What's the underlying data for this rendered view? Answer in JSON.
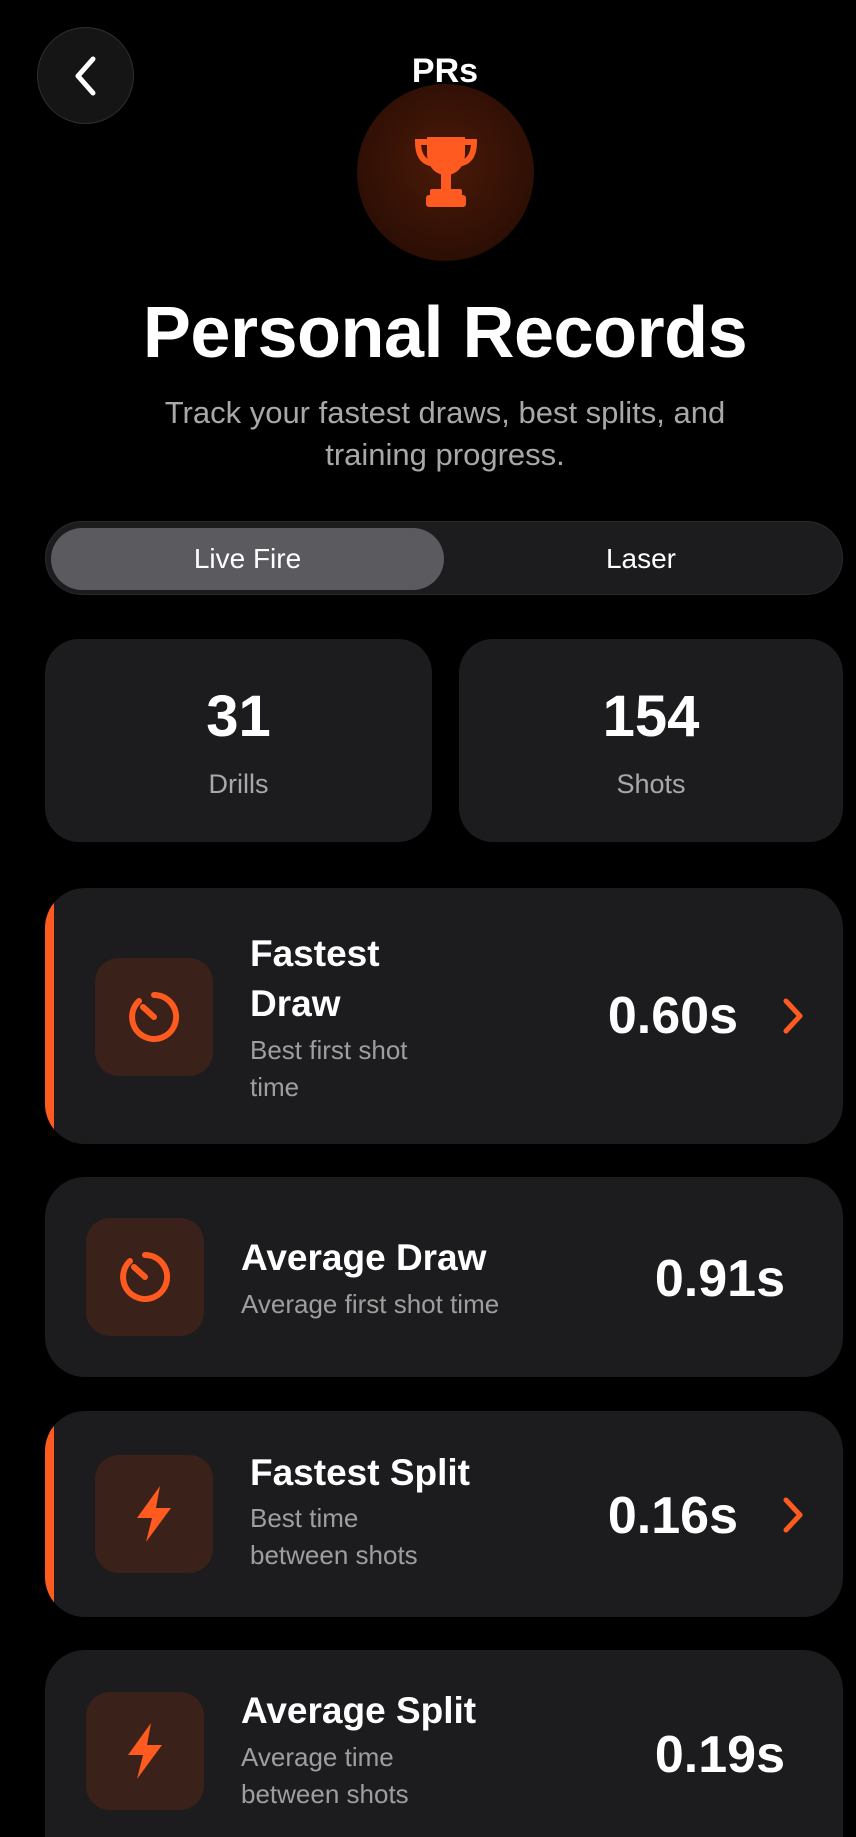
{
  "nav": {
    "title": "PRs"
  },
  "hero": {
    "title": "Personal Records",
    "subtitle": "Track your fastest draws, best splits, and training progress."
  },
  "segmented": {
    "options": [
      "Live Fire",
      "Laser"
    ],
    "selected": "Live Fire"
  },
  "stats": [
    {
      "value": "31",
      "label": "Drills"
    },
    {
      "value": "154",
      "label": "Shots"
    }
  ],
  "records": [
    {
      "title": "Fastest Draw",
      "subtitle": "Best first shot time",
      "value": "0.60s",
      "icon": "stopwatch-icon",
      "highlighted": true
    },
    {
      "title": "Average Draw",
      "subtitle": "Average first shot time",
      "value": "0.91s",
      "icon": "stopwatch-icon",
      "highlighted": false
    },
    {
      "title": "Fastest Split",
      "subtitle": "Best time between shots",
      "value": "0.16s",
      "icon": "lightning-icon",
      "highlighted": true
    },
    {
      "title": "Average Split",
      "subtitle": "Average time between shots",
      "value": "0.19s",
      "icon": "lightning-icon",
      "highlighted": false
    }
  ],
  "colors": {
    "accent": "#ff5a1f",
    "background": "#000000",
    "card": "#1c1c1e",
    "icon_tile": "#3a2119",
    "segment_active": "#5b5b5f",
    "muted_text": "#a8a8a8"
  }
}
